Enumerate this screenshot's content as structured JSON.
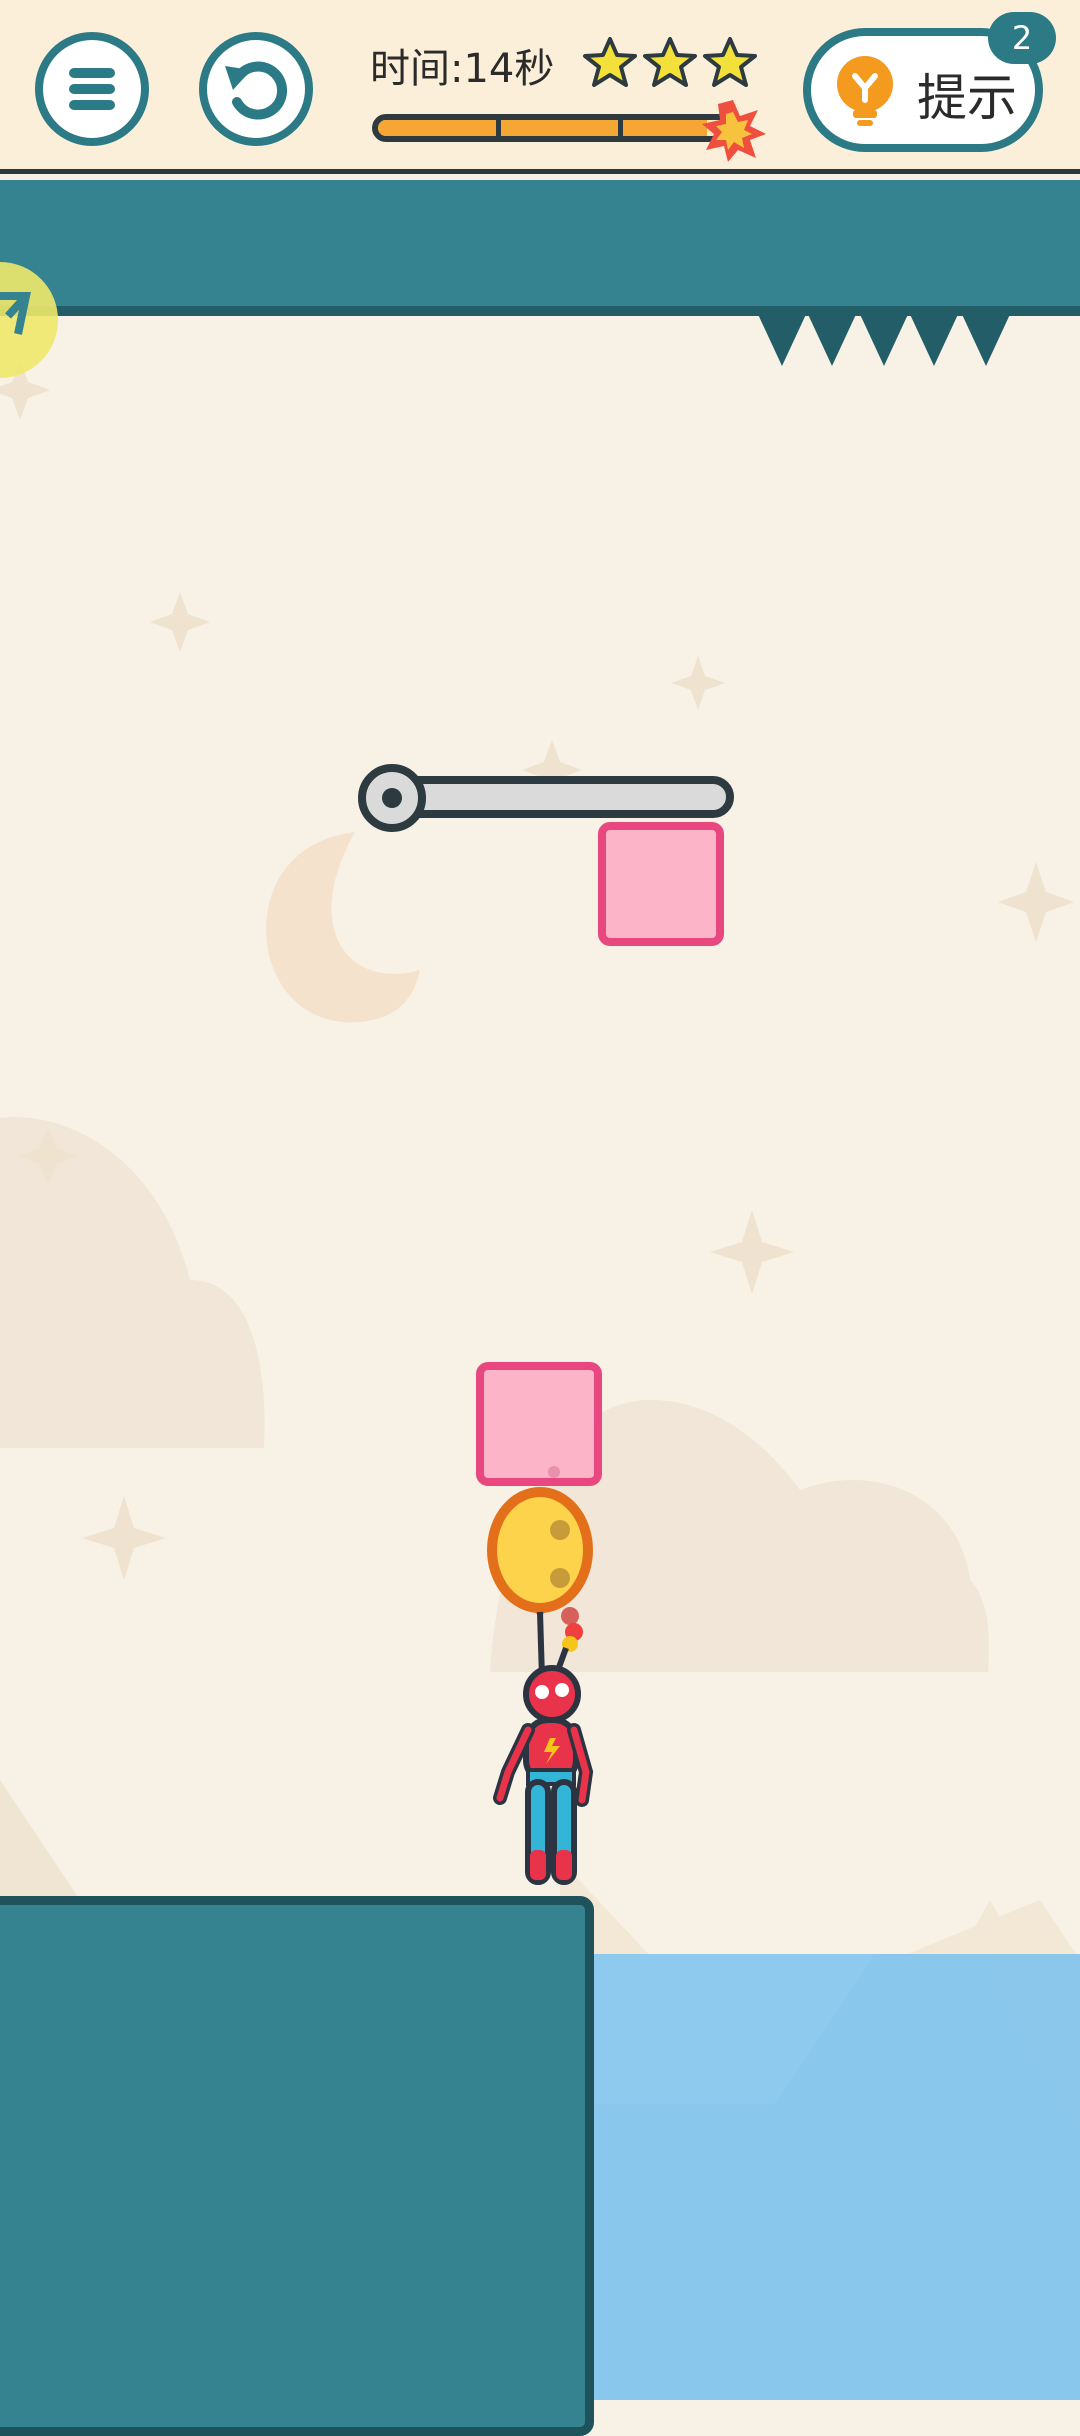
{
  "hud": {
    "timer_text": "时间:14秒",
    "stars_earned": 3,
    "progress_fraction": 0.92,
    "hint_label": "提示",
    "hint_count": "2"
  },
  "icons": {
    "menu": "menu-icon",
    "restart": "restart-icon",
    "star": "star-icon",
    "burst": "burst-icon",
    "hint": "lightbulb-icon"
  },
  "colors": {
    "teal": "#358390",
    "teal_dark": "#235e68",
    "pink_block": "#fbb4c8",
    "pink_border": "#e8487f",
    "star_yellow": "#f3e13a",
    "progress_orange": "#f6a634",
    "water": "#89c8ec",
    "background": "#f8f1e6"
  }
}
